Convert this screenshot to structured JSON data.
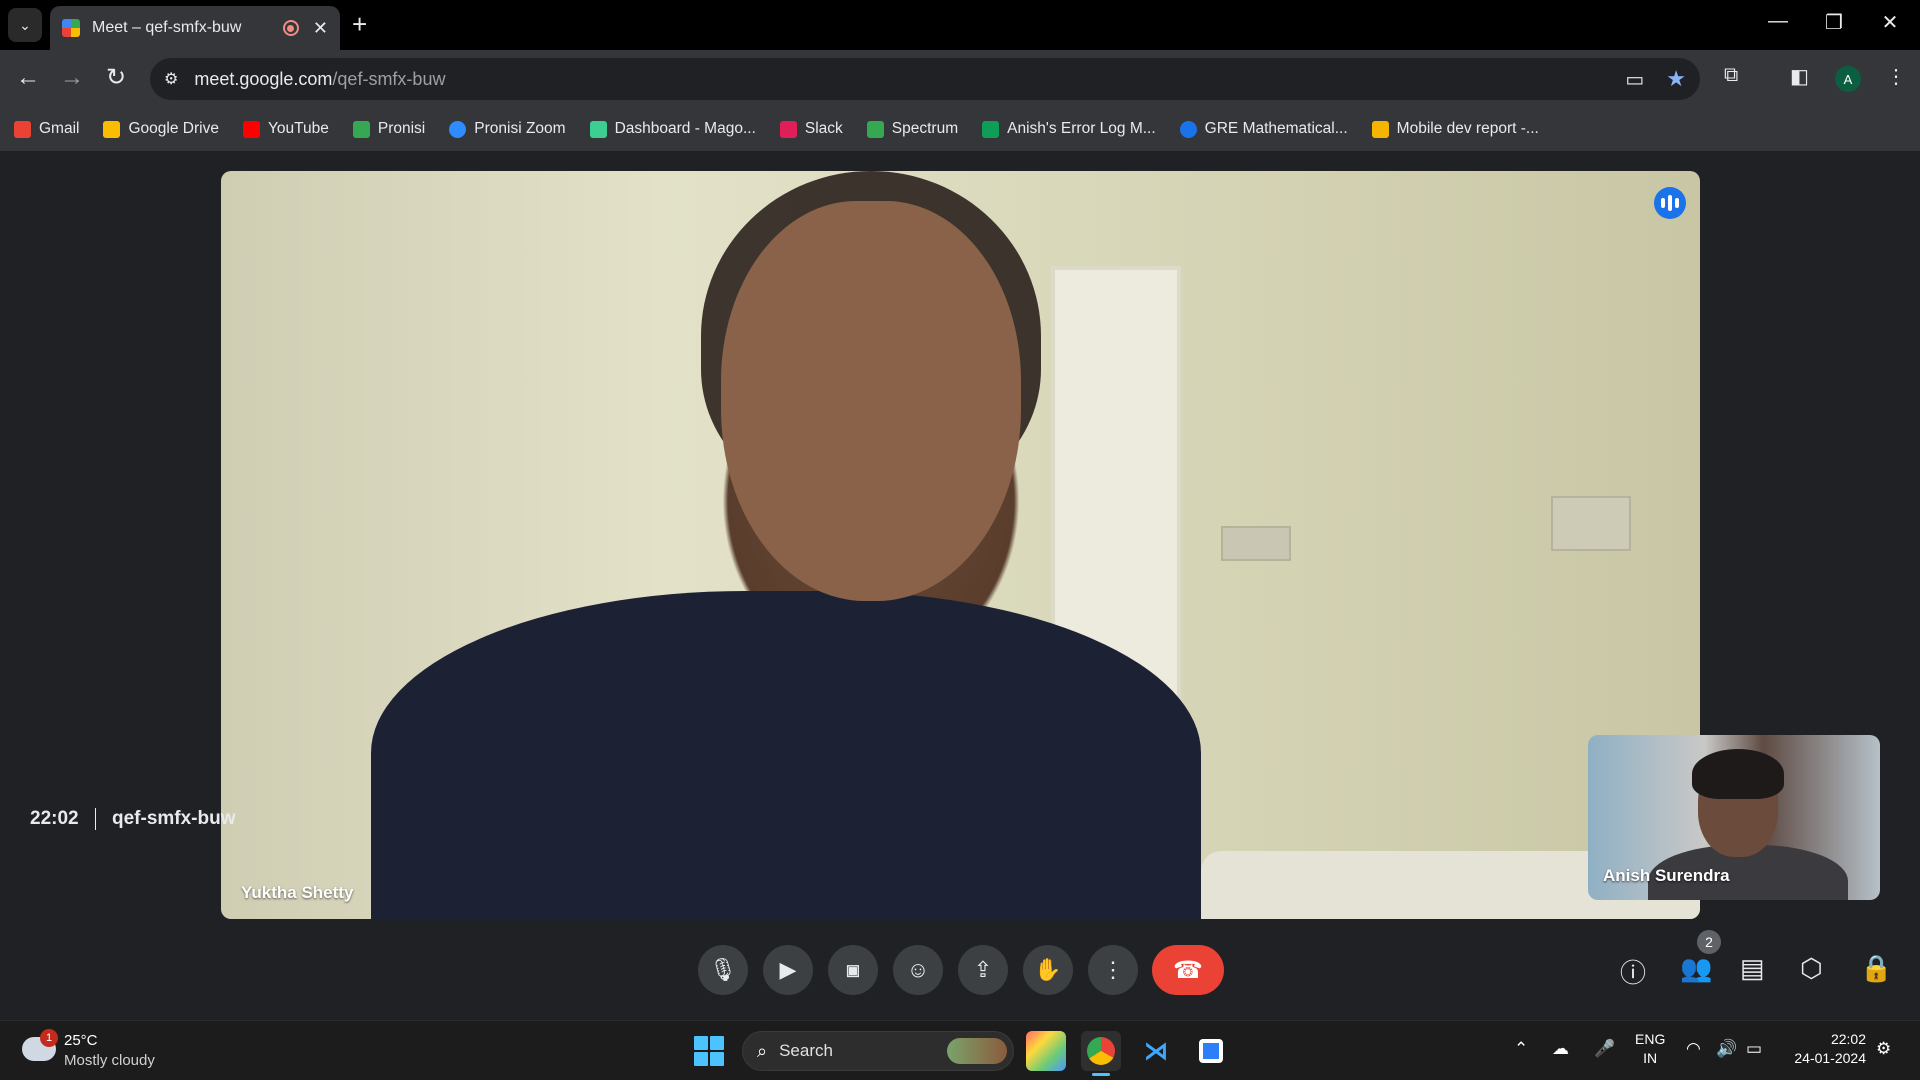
{
  "browser": {
    "tab_title": "Meet – qef-smfx-buw",
    "url_host": "meet.google.com",
    "url_path": "/qef-smfx-buw",
    "profile_initial": "A"
  },
  "bookmarks": [
    {
      "label": "Gmail",
      "color": "#ea4335"
    },
    {
      "label": "Google Drive",
      "color": "#fbbc04"
    },
    {
      "label": "YouTube",
      "color": "#ff0000"
    },
    {
      "label": "Pronisi",
      "color": "#34a853"
    },
    {
      "label": "Pronisi Zoom",
      "color": "#2d8cff"
    },
    {
      "label": "Dashboard - Mago...",
      "color": "#3ccf91"
    },
    {
      "label": "Slack",
      "color": "#e01e5a"
    },
    {
      "label": "Spectrum",
      "color": "#34a853"
    },
    {
      "label": "Anish's Error Log M...",
      "color": "#0f9d58"
    },
    {
      "label": "GRE Mathematical...",
      "color": "#1a73e8"
    },
    {
      "label": "Mobile dev report -...",
      "color": "#f4b400"
    }
  ],
  "meet": {
    "main_participant": "Yuktha Shetty",
    "self_participant": "Anish Surendra",
    "time": "22:02",
    "meeting_code": "qef-smfx-buw",
    "participant_count": "2"
  },
  "taskbar": {
    "weather_badge": "1",
    "temperature": "25°C",
    "condition": "Mostly cloudy",
    "search_label": "Search",
    "lang_line1": "ENG",
    "lang_line2": "IN",
    "clock_time": "22:02",
    "clock_date": "24-01-2024"
  }
}
